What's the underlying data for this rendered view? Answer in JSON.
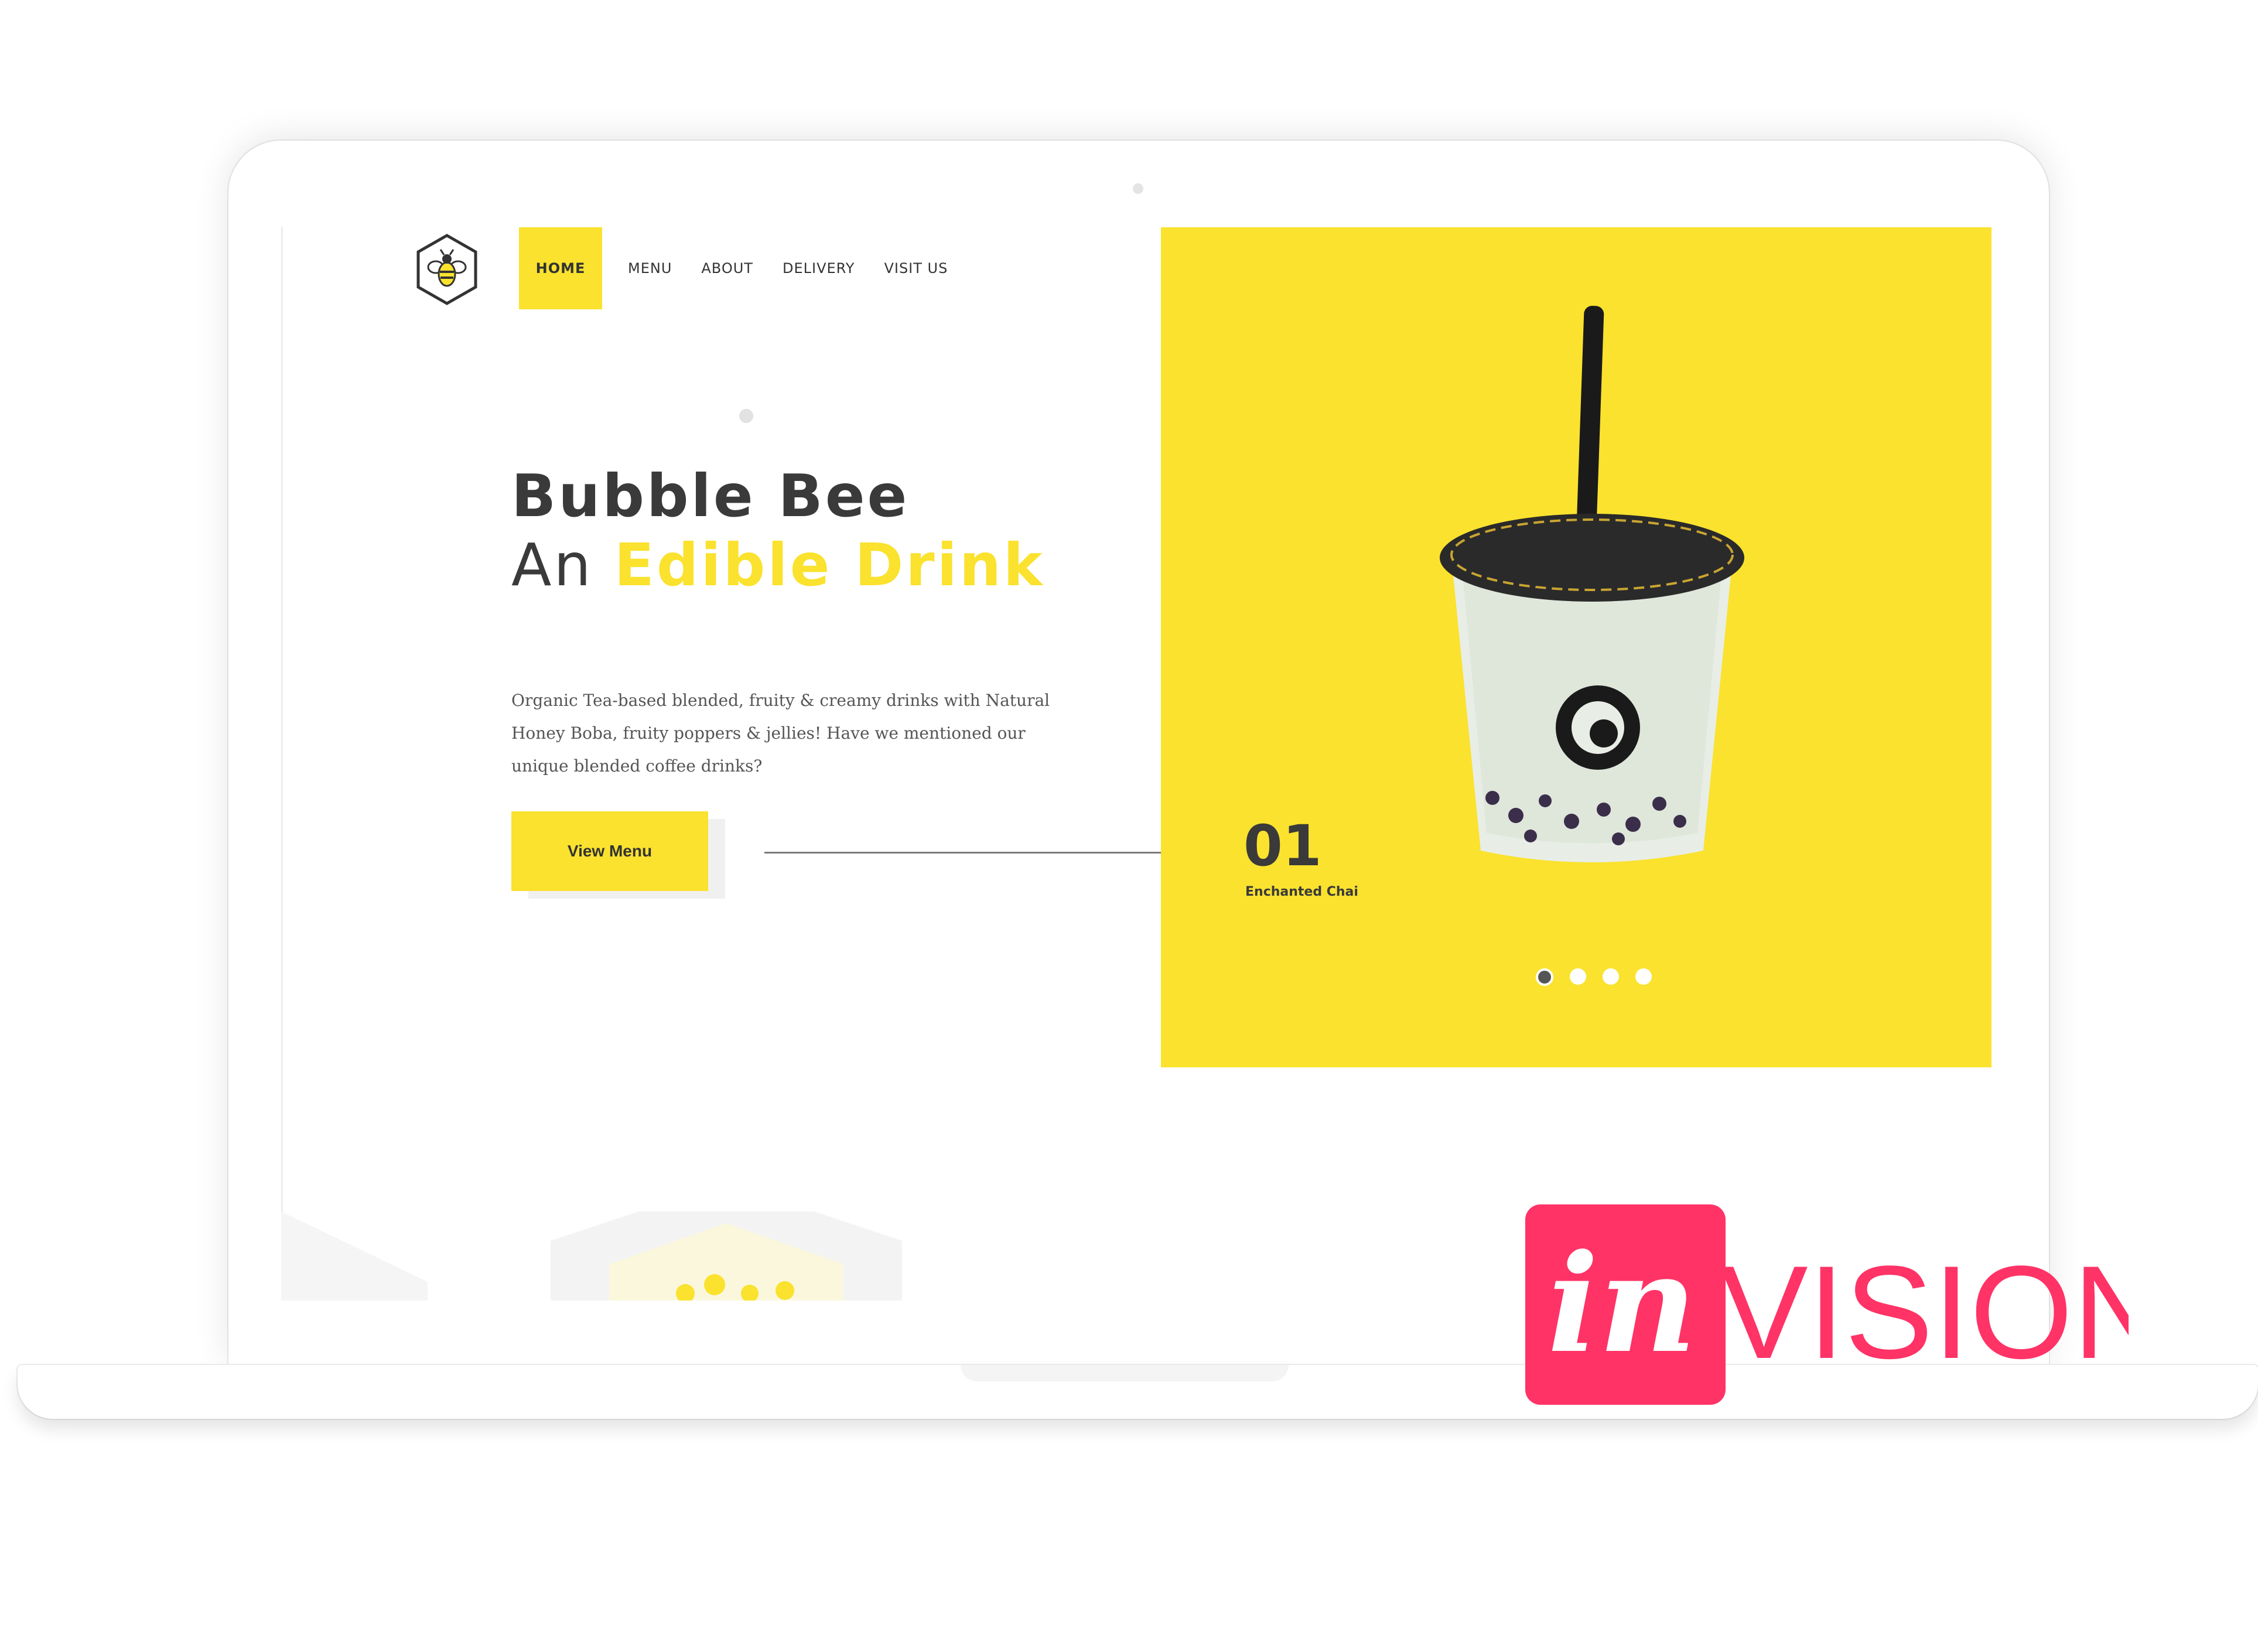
{
  "brand": {
    "accent_color": "#FAE22E",
    "text_dark": "#3a3a3a",
    "logo_icon": "bee-hexagon-logo"
  },
  "nav": {
    "items": [
      {
        "label": "HOME",
        "active": true
      },
      {
        "label": "MENU"
      },
      {
        "label": "ABOUT"
      },
      {
        "label": "DELIVERY"
      },
      {
        "label": "VISIT US"
      }
    ]
  },
  "hero": {
    "title_line1": "Bubble Bee",
    "title_line2_plain": "An ",
    "title_line2_accent": "Edible Drink",
    "description": "Organic Tea-based blended, fruity & creamy drinks with Natural Honey Boba, fruity poppers & jellies! Have we mentioned our unique blended coffee drinks?",
    "cta_label": "View Menu"
  },
  "slider": {
    "number": "01",
    "name": "Enchanted Chai",
    "dot_count": 4,
    "active_index": 0,
    "image_icon": "bubble-tea-cup-image"
  },
  "overlay": {
    "logo_prefix": "in",
    "logo_text": "VISION",
    "logo_color": "#FF3366"
  }
}
